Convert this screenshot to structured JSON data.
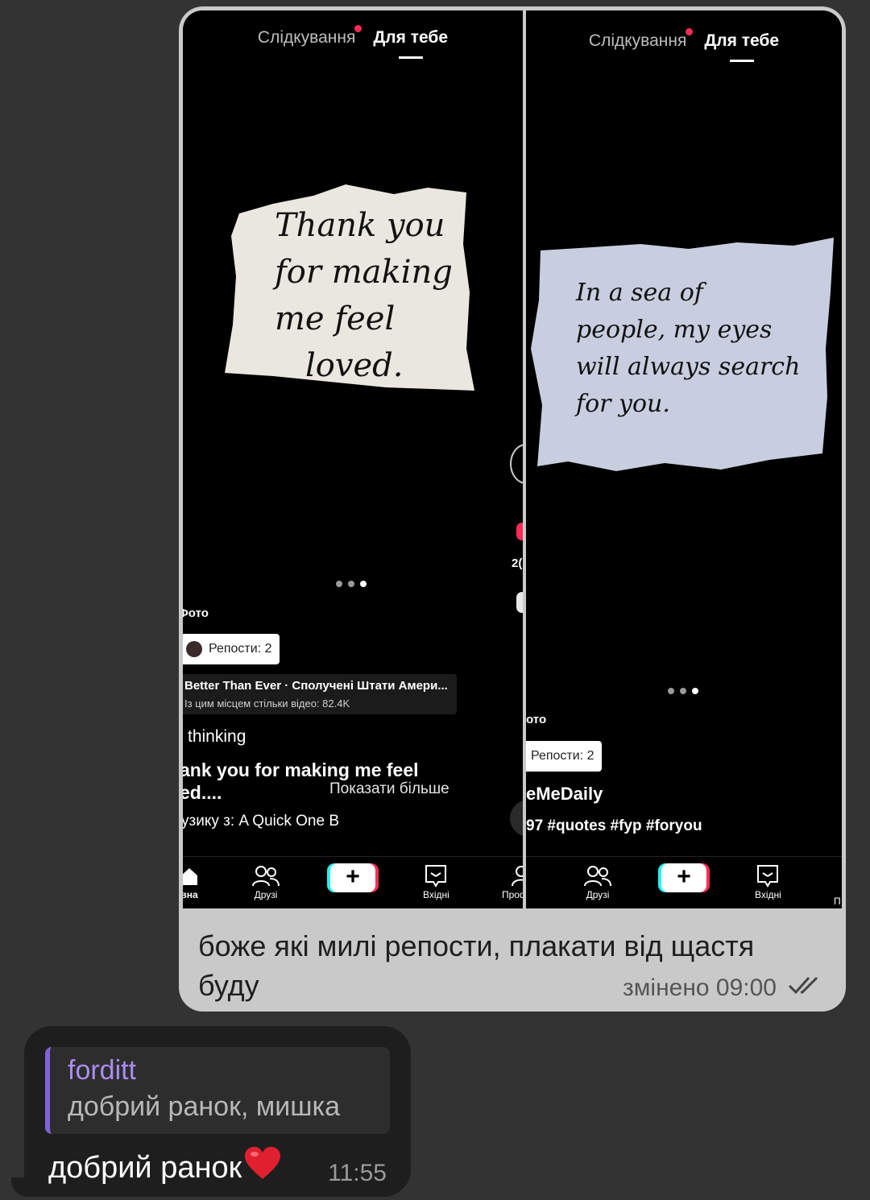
{
  "outgoing_message": {
    "text": "боже які милі репости, плакати від щастя буду",
    "edited_time": "змінено 09:00",
    "screenshots": [
      {
        "tabs": {
          "following": "Слідкування",
          "for_you": "Для тебе"
        },
        "note_lines": [
          "Thank you",
          "for making",
          "me feel",
          "loved."
        ],
        "photo_label": "Фото",
        "reposts": "Репости: 2",
        "location_title": "Better Than Ever · Сполучені Штати Амери...",
        "location_sub": "Із цим місцем стільки відео: 82.4K",
        "caption_1": "thinking",
        "caption_2": "ank you for making me feel",
        "caption_3": "ed....",
        "show_more": "Показати більше",
        "music": "узику з: A Quick One B",
        "side_count": "2(",
        "nav": {
          "home": "вна",
          "friends": "Друзі",
          "inbox": "Вхідні",
          "profile": "Профіль"
        }
      },
      {
        "tabs": {
          "following": "Слідкування",
          "for_you": "Для тебе"
        },
        "note_lines": [
          "In a sea of",
          "people, my eyes",
          "will always search",
          "for you."
        ],
        "photo_label": "ото",
        "reposts": "Репости: 2",
        "author": "eMeDaily",
        "hashtags": "97 #quotes #fyp #foryou",
        "nav": {
          "friends": "Друзі",
          "inbox": "Вхідні",
          "profile": "П"
        }
      }
    ]
  },
  "incoming_message": {
    "reply_to_name": "forditt",
    "reply_to_text": "добрий ранок, мишка",
    "text": "добрий ранок",
    "emoji": "heart",
    "time": "11:55"
  },
  "colors": {
    "background": "#333333",
    "outgoing_bubble": "#c9c9c9",
    "incoming_bubble": "#1e1e1e",
    "reply_accent": "#7f63d8",
    "tiktok_red": "#fe2c55",
    "tiktok_cyan": "#25f4ee"
  }
}
